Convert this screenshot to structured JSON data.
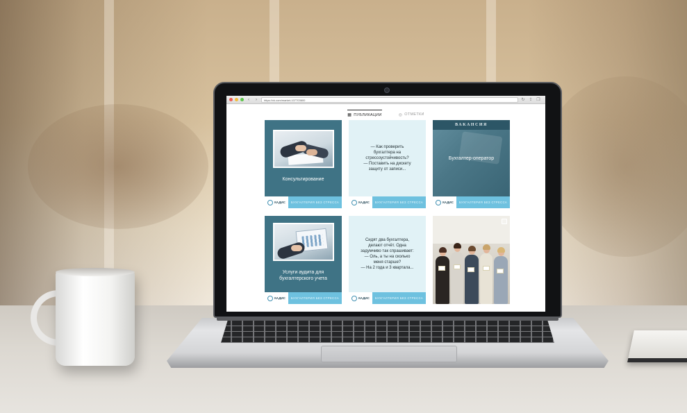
{
  "browser": {
    "url": "https://vk.com/market-107703600",
    "nav_back": "‹",
    "nav_forward": "›"
  },
  "tabs": [
    {
      "label": "ПУБЛИКАЦИИ",
      "icon": "grid-icon",
      "active": true
    },
    {
      "label": "ОТМЕТКИ",
      "icon": "tag-icon",
      "active": false
    }
  ],
  "posts": [
    {
      "type": "image-title",
      "title": "Консультирование",
      "logo": "КАДИС",
      "tag": "БУХГАЛТЕРИЯ БЕЗ СТРЕССА"
    },
    {
      "type": "quote",
      "text": "— Как проверить\nбухгалтера на\nстрессоустойчивость?\n— Поставить на дискету\nзащиту от записи...",
      "logo": "КАДИС",
      "tag": "БУХГАЛТЕРИЯ БЕЗ СТРЕССА"
    },
    {
      "type": "vacancy",
      "header": "ВАКАНСИЯ",
      "title": "Бухгалтер-оператор",
      "logo": "КАДИС",
      "tag": "БУХГАЛТЕРИЯ БЕЗ СТРЕССА"
    },
    {
      "type": "image-title",
      "title": "Услуги аудита для бухгалтерского учета",
      "logo": "КАДИС",
      "tag": "БУХГАЛТЕРИЯ БЕЗ СТРЕССА"
    },
    {
      "type": "quote",
      "text": "Сидят два бухгалтера,\nделают отчёт. Одна\nзадумчиво так спрашивает:\n— Оль, а ты на сколько\nменя старше?\n— На 2 года и 3 квартала...",
      "logo": "КАДИС",
      "tag": "БУХГАЛТЕРИЯ БЕЗ СТРЕССА"
    },
    {
      "type": "photo"
    }
  ],
  "colors": {
    "card_dark": "#3f7385",
    "card_light": "#e1f2f6",
    "tag_bar": "#6ec1df"
  }
}
